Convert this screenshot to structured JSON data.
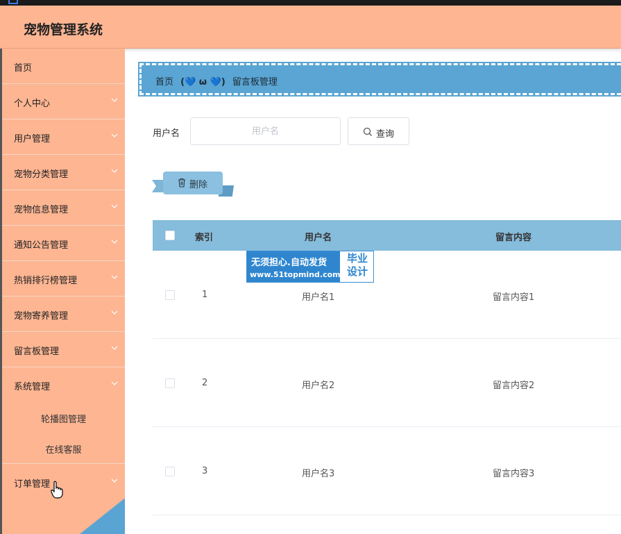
{
  "app": {
    "title": "宠物管理系统"
  },
  "sidebar": {
    "items": [
      {
        "label": "首页",
        "has_children": false
      },
      {
        "label": "个人中心",
        "has_children": true
      },
      {
        "label": "用户管理",
        "has_children": true
      },
      {
        "label": "宠物分类管理",
        "has_children": true
      },
      {
        "label": "宠物信息管理",
        "has_children": true
      },
      {
        "label": "通知公告管理",
        "has_children": true
      },
      {
        "label": "热销排行榜管理",
        "has_children": true
      },
      {
        "label": "宠物寄养管理",
        "has_children": true
      },
      {
        "label": "留言板管理",
        "has_children": true
      },
      {
        "label": "系统管理",
        "has_children": true,
        "expanded": true
      },
      {
        "label": "订单管理",
        "has_children": true
      }
    ],
    "system_subitems": [
      {
        "label": "轮播图管理"
      },
      {
        "label": "在线客服"
      }
    ]
  },
  "breadcrumb": {
    "home": "首页",
    "separator": "(💙 ω 💙)",
    "current": "留言板管理"
  },
  "filter": {
    "label": "用户名",
    "placeholder": "用户名",
    "search_label": "查询"
  },
  "actions": {
    "delete_label": "删除"
  },
  "table": {
    "columns": [
      "索引",
      "用户名",
      "留言内容"
    ],
    "rows": [
      {
        "index": "1",
        "username": "用户名1",
        "content": "留言内容1"
      },
      {
        "index": "2",
        "username": "用户名2",
        "content": "留言内容2"
      },
      {
        "index": "3",
        "username": "用户名3",
        "content": "留言内容3"
      }
    ]
  },
  "watermark": {
    "line1": "无须担心.自动发货",
    "line2": "www.51topmind.com",
    "badge_line1": "毕业",
    "badge_line2": "设计"
  },
  "colors": {
    "header_bg": "#fdb592",
    "breadcrumb_bg": "#5aa5d3",
    "table_header_bg": "#86bcdc",
    "delete_button_bg": "#8cc0e0",
    "watermark_blue": "#2f86cf"
  }
}
